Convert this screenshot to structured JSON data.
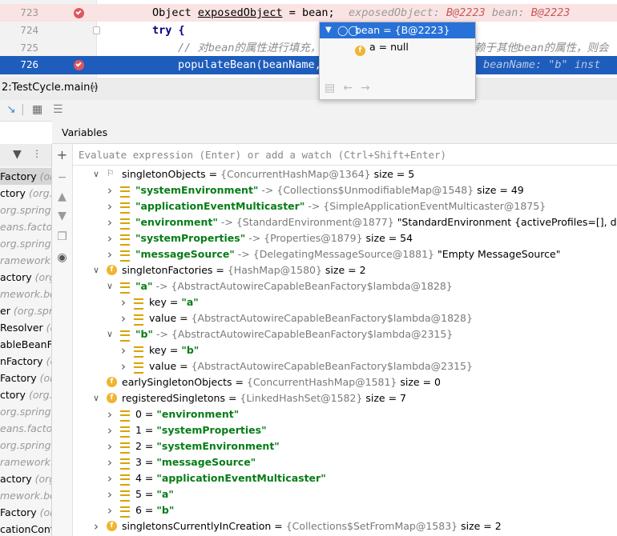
{
  "editor": {
    "lines": [
      {
        "num": "723",
        "code_a": "Object ",
        "code_b": "exposedObject",
        "code_c": " = bean;",
        "hint1_name": "exposedObject: ",
        "hint1_val": "B@2223",
        "hint2_name": "bean: ",
        "hint2_val": "B@2223"
      },
      {
        "num": "724",
        "code": "try {"
      },
      {
        "num": "725",
        "comment": "// 对bean的属性进行填充，",
        "comment_tail": "在依赖于其他bean的属性，则会"
      },
      {
        "num": "726",
        "code": "populateBean(beanName,",
        "hint_name": "beanName: ",
        "hint_val": "\"b\"",
        "hint_tail": "inst"
      }
    ],
    "popup": {
      "title": "bean = {B@2223}",
      "field_name": "a",
      "field_value": " = null",
      "glasses_icon": "eyeglasses-icon"
    }
  },
  "debug": {
    "frame_tab": "2:TestCycle.main()",
    "frame_tab_close": "×",
    "variables_label": "Variables",
    "eval_placeholder": "Evaluate expression (Enter) or add a watch (Ctrl+Shift+Enter)",
    "frames": [
      {
        "name": "Factory",
        "pkg": " (org",
        "selected": true
      },
      {
        "name": "ctory",
        "pkg": " (org.s"
      },
      {
        "name": "",
        "pkg": "org.springf"
      },
      {
        "name": "",
        "pkg": "eans.factory"
      },
      {
        "name": "",
        "pkg": "org.springfra"
      },
      {
        "name": "",
        "pkg": "ramework.b"
      },
      {
        "name": "actory",
        "pkg": " (org.s"
      },
      {
        "name": "",
        "pkg": "mework.bea"
      },
      {
        "name": "er",
        "pkg": " (org.sprin"
      },
      {
        "name": "Resolver",
        "pkg": " (o"
      },
      {
        "name": "ableBeanFac",
        "pkg": ""
      },
      {
        "name": "nFactory",
        "pkg": " (or"
      },
      {
        "name": "Factory",
        "pkg": " (or"
      },
      {
        "name": "ctory",
        "pkg": " (org.s"
      },
      {
        "name": "",
        "pkg": "org.spring"
      },
      {
        "name": "",
        "pkg": "eans.factory"
      },
      {
        "name": "",
        "pkg": "org.springfr"
      },
      {
        "name": "",
        "pkg": "ramework.b"
      },
      {
        "name": "actory",
        "pkg": " (org."
      },
      {
        "name": "",
        "pkg": "mework.bea"
      },
      {
        "name": "Factory",
        "pkg": " (org"
      },
      {
        "name": "cationConte",
        "pkg": ""
      }
    ],
    "tree": [
      {
        "depth": 1,
        "arrow": "open",
        "icon": "flag",
        "name": "singletonObjects",
        "rest": [
          [
            "op",
            " = "
          ],
          [
            "ty",
            "{ConcurrentHashMap@1364}"
          ],
          [
            "plain",
            "  size = 5"
          ]
        ]
      },
      {
        "depth": 2,
        "arrow": "closed",
        "icon": "lines",
        "key": "\"systemEnvironment\"",
        "rest": [
          [
            "ar",
            " -> "
          ],
          [
            "ty",
            "{Collections$UnmodifiableMap@1548}"
          ],
          [
            "plain",
            "  size = 49"
          ]
        ]
      },
      {
        "depth": 2,
        "arrow": "closed",
        "icon": "lines",
        "key": "\"applicationEventMulticaster\"",
        "rest": [
          [
            "ar",
            " -> "
          ],
          [
            "ty",
            "{SimpleApplicationEventMulticaster@1875}"
          ]
        ]
      },
      {
        "depth": 2,
        "arrow": "closed",
        "icon": "lines",
        "key": "\"environment\"",
        "rest": [
          [
            "ar",
            " -> "
          ],
          [
            "ty",
            "{StandardEnvironment@1877} "
          ],
          [
            "plain",
            "\"StandardEnvironment {activeProfiles=[], defaultProfiles"
          ]
        ]
      },
      {
        "depth": 2,
        "arrow": "closed",
        "icon": "lines",
        "key": "\"systemProperties\"",
        "rest": [
          [
            "ar",
            " -> "
          ],
          [
            "ty",
            "{Properties@1879}"
          ],
          [
            "plain",
            "  size = 54"
          ]
        ]
      },
      {
        "depth": 2,
        "arrow": "closed",
        "icon": "lines",
        "key": "\"messageSource\"",
        "rest": [
          [
            "ar",
            " -> "
          ],
          [
            "ty",
            "{DelegatingMessageSource@1881} "
          ],
          [
            "plain",
            "\"Empty MessageSource\""
          ]
        ]
      },
      {
        "depth": 1,
        "arrow": "open",
        "icon": "f",
        "name": "singletonFactories",
        "rest": [
          [
            "op",
            " = "
          ],
          [
            "ty",
            "{HashMap@1580}"
          ],
          [
            "plain",
            "  size = 2"
          ]
        ]
      },
      {
        "depth": 2,
        "arrow": "open",
        "icon": "lines",
        "key": "\"a\"",
        "rest": [
          [
            "ar",
            " -> "
          ],
          [
            "ty",
            "{AbstractAutowireCapableBeanFactory$lambda@1828}"
          ]
        ]
      },
      {
        "depth": 3,
        "arrow": "closed",
        "icon": "lines",
        "name": "key",
        "rest": [
          [
            "op",
            " = "
          ],
          [
            "str",
            "\"a\""
          ]
        ]
      },
      {
        "depth": 3,
        "arrow": "closed",
        "icon": "lines",
        "name": "value",
        "rest": [
          [
            "op",
            " = "
          ],
          [
            "ty",
            "{AbstractAutowireCapableBeanFactory$lambda@1828}"
          ]
        ]
      },
      {
        "depth": 2,
        "arrow": "open",
        "icon": "lines",
        "key": "\"b\"",
        "rest": [
          [
            "ar",
            " -> "
          ],
          [
            "ty",
            "{AbstractAutowireCapableBeanFactory$lambda@2315}"
          ]
        ]
      },
      {
        "depth": 3,
        "arrow": "closed",
        "icon": "lines",
        "name": "key",
        "rest": [
          [
            "op",
            " = "
          ],
          [
            "str",
            "\"b\""
          ]
        ]
      },
      {
        "depth": 3,
        "arrow": "closed",
        "icon": "lines",
        "name": "value",
        "rest": [
          [
            "op",
            " = "
          ],
          [
            "ty",
            "{AbstractAutowireCapableBeanFactory$lambda@2315}"
          ]
        ]
      },
      {
        "depth": 1,
        "arrow": "none",
        "icon": "f",
        "name": "earlySingletonObjects",
        "rest": [
          [
            "op",
            " = "
          ],
          [
            "ty",
            "{ConcurrentHashMap@1581}"
          ],
          [
            "plain",
            "  size = 0"
          ]
        ]
      },
      {
        "depth": 1,
        "arrow": "open",
        "icon": "f",
        "name": "registeredSingletons",
        "rest": [
          [
            "op",
            " = "
          ],
          [
            "ty",
            "{LinkedHashSet@1582}"
          ],
          [
            "plain",
            "  size = 7"
          ]
        ]
      },
      {
        "depth": 2,
        "arrow": "closed",
        "icon": "lines",
        "name": "0",
        "rest": [
          [
            "op",
            " = "
          ],
          [
            "str",
            "\"environment\""
          ]
        ]
      },
      {
        "depth": 2,
        "arrow": "closed",
        "icon": "lines",
        "name": "1",
        "rest": [
          [
            "op",
            " = "
          ],
          [
            "str",
            "\"systemProperties\""
          ]
        ]
      },
      {
        "depth": 2,
        "arrow": "closed",
        "icon": "lines",
        "name": "2",
        "rest": [
          [
            "op",
            " = "
          ],
          [
            "str",
            "\"systemEnvironment\""
          ]
        ]
      },
      {
        "depth": 2,
        "arrow": "closed",
        "icon": "lines",
        "name": "3",
        "rest": [
          [
            "op",
            " = "
          ],
          [
            "str",
            "\"messageSource\""
          ]
        ]
      },
      {
        "depth": 2,
        "arrow": "closed",
        "icon": "lines",
        "name": "4",
        "rest": [
          [
            "op",
            " = "
          ],
          [
            "str",
            "\"applicationEventMulticaster\""
          ]
        ]
      },
      {
        "depth": 2,
        "arrow": "closed",
        "icon": "lines",
        "name": "5",
        "rest": [
          [
            "op",
            " = "
          ],
          [
            "str",
            "\"a\""
          ]
        ]
      },
      {
        "depth": 2,
        "arrow": "closed",
        "icon": "lines",
        "name": "6",
        "rest": [
          [
            "op",
            " = "
          ],
          [
            "str",
            "\"b\""
          ]
        ]
      },
      {
        "depth": 1,
        "arrow": "closed",
        "icon": "f",
        "name": "singletonsCurrentlyInCreation",
        "rest": [
          [
            "op",
            " = "
          ],
          [
            "ty",
            "{Collections$SetFromMap@1583}"
          ],
          [
            "plain",
            "  size = 2"
          ]
        ]
      }
    ]
  },
  "colors": {
    "breakpoint": "#db5860",
    "execution_line": "#1e5dbc",
    "string_green": "#067d17",
    "field_icon": "#f0b431"
  }
}
